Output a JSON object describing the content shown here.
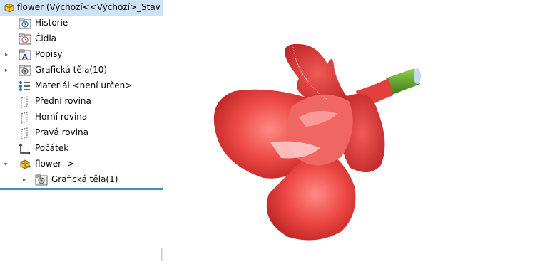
{
  "tree": {
    "root_label": "flower  (Výchozí<<Výchozí>_Stav zobr",
    "items": [
      {
        "label": "Historie",
        "icon": "history-folder-icon"
      },
      {
        "label": "Čidla",
        "icon": "sensors-folder-icon"
      },
      {
        "label": "Popisy",
        "icon": "annotations-icon"
      },
      {
        "label": "Grafická těla(10)",
        "icon": "graphic-bodies-icon"
      },
      {
        "label": "Materiál <není určen>",
        "icon": "material-icon"
      },
      {
        "label": "Přední rovina",
        "icon": "plane-icon"
      },
      {
        "label": "Horní rovina",
        "icon": "plane-icon"
      },
      {
        "label": "Pravá rovina",
        "icon": "plane-icon"
      },
      {
        "label": "Počátek",
        "icon": "origin-icon"
      },
      {
        "label": "flower ->",
        "icon": "part-icon"
      },
      {
        "label": "Grafická těla(1)",
        "icon": "graphic-bodies-icon"
      }
    ]
  },
  "colors": {
    "selection": "#cfe3f6",
    "separator": "#3a8fd0",
    "petal": "#e8423f",
    "stem": "#5a9a2a"
  }
}
